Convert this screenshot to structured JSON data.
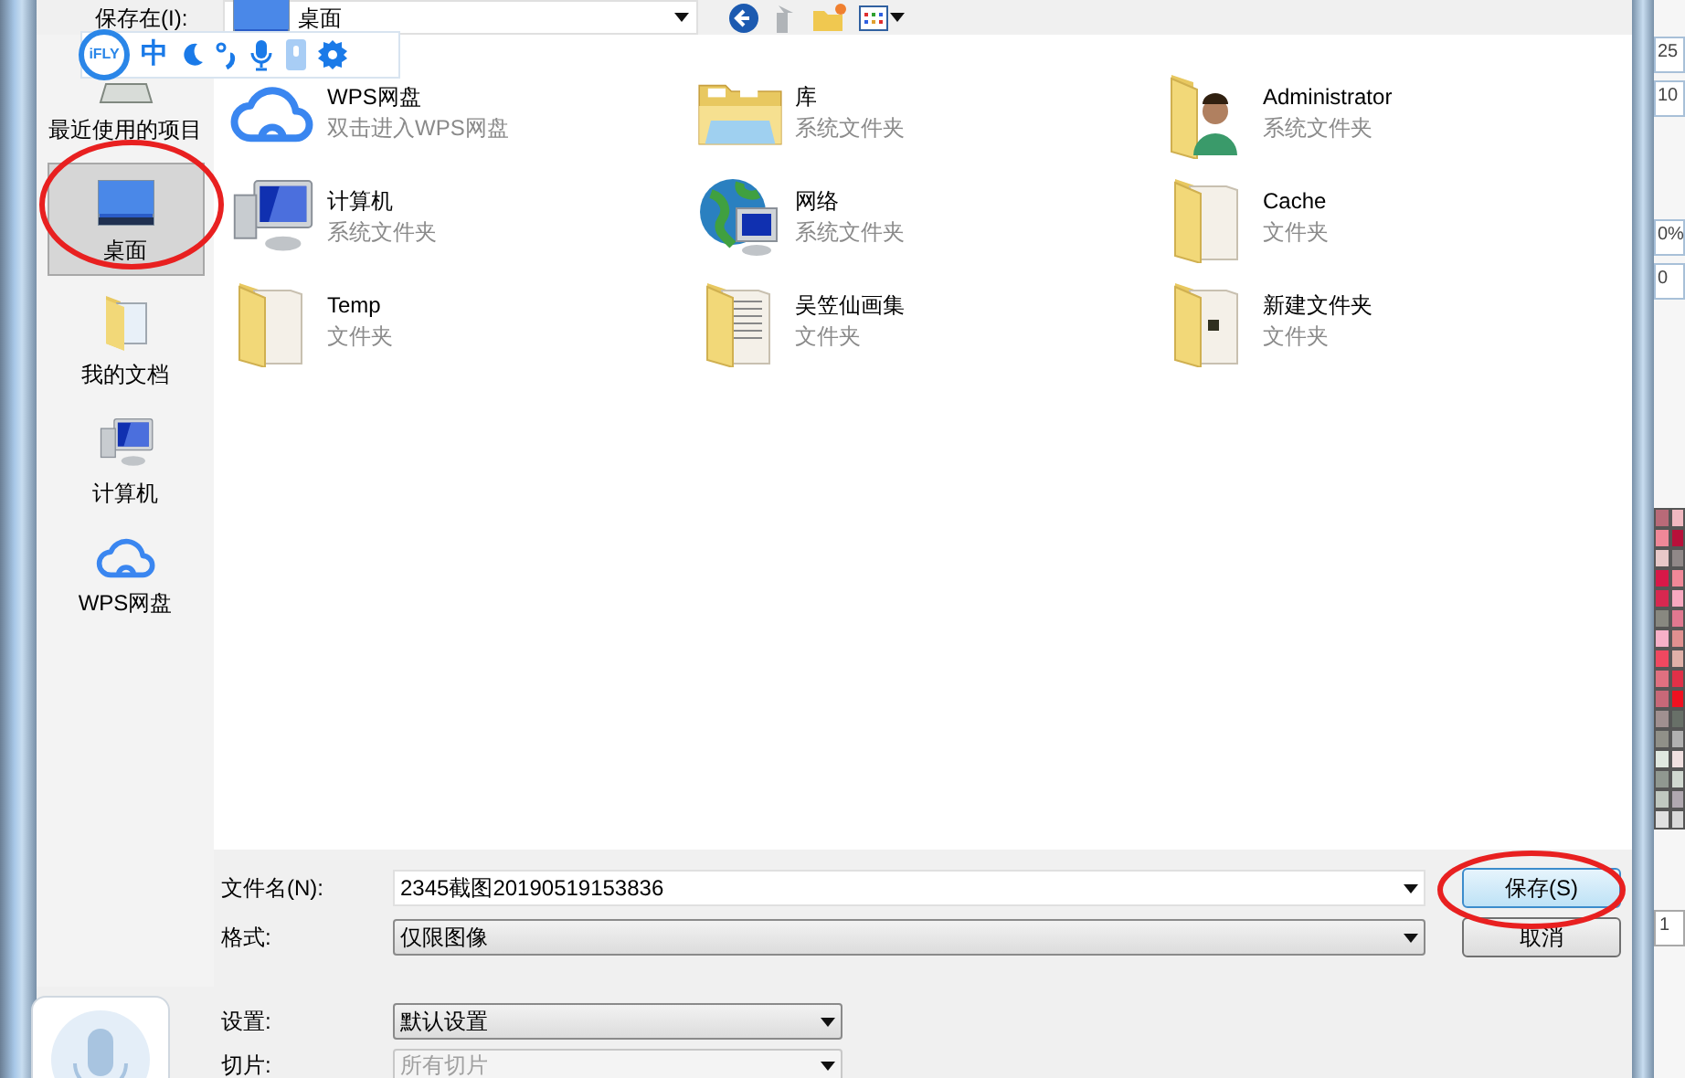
{
  "toolbar": {
    "label": "保存在(I):",
    "location": "桌面"
  },
  "ime_bar": {
    "logo": "iFLY",
    "mode": "中"
  },
  "sidebar": {
    "items": [
      {
        "label": "最近使用的项目",
        "kind": "recent",
        "selected": false
      },
      {
        "label": "桌面",
        "kind": "desktop",
        "selected": true
      },
      {
        "label": "我的文档",
        "kind": "documents",
        "selected": false
      },
      {
        "label": "计算机",
        "kind": "computer",
        "selected": false
      },
      {
        "label": "WPS网盘",
        "kind": "cloud",
        "selected": false
      }
    ]
  },
  "files": [
    {
      "name": "WPS网盘",
      "type": "双击进入WPS网盘",
      "kind": "cloud"
    },
    {
      "name": "库",
      "type": "系统文件夹",
      "kind": "library"
    },
    {
      "name": "Administrator",
      "type": "系统文件夹",
      "kind": "user"
    },
    {
      "name": "计算机",
      "type": "系统文件夹",
      "kind": "computer"
    },
    {
      "name": "网络",
      "type": "系统文件夹",
      "kind": "network"
    },
    {
      "name": "Cache",
      "type": "文件夹",
      "kind": "folder"
    },
    {
      "name": "Temp",
      "type": "文件夹",
      "kind": "folder"
    },
    {
      "name": "吴笠仙画集",
      "type": "文件夹",
      "kind": "docfolder"
    },
    {
      "name": "新建文件夹",
      "type": "文件夹",
      "kind": "imgfolder"
    }
  ],
  "form": {
    "filename_label": "文件名(N):",
    "filename": "2345截图20190519153836",
    "format_label": "格式:",
    "format": "仅限图像",
    "settings_label": "设置:",
    "settings": "默认设置",
    "slice_label": "切片:",
    "slice": "所有切片",
    "slice_disabled": true
  },
  "buttons": [
    {
      "label": "保存(S)",
      "default": true
    },
    {
      "label": "取消",
      "default": false
    }
  ],
  "side_panel": {
    "fields": [
      "25",
      "10",
      "0%",
      "0"
    ],
    "bottom_field": "1",
    "swatches": [
      {
        "color": "#b96a78"
      },
      {
        "color": "#f0b8c0"
      },
      {
        "color": "#f08898"
      },
      {
        "color": "#b8103a"
      },
      {
        "color": "#e8c8c8"
      },
      {
        "color": "#908888"
      },
      {
        "color": "#d81848"
      },
      {
        "color": "#f08898"
      },
      {
        "color": "#d82850"
      },
      {
        "color": "#f8a8c0"
      },
      {
        "color": "#888880"
      },
      {
        "color": "#e07890"
      },
      {
        "color": "#f8b0c8"
      },
      {
        "color": "#e09090"
      },
      {
        "color": "#f04860"
      },
      {
        "color": "#e0b0a8"
      },
      {
        "color": "#e07080"
      },
      {
        "color": "#e03048"
      },
      {
        "color": "#c86878"
      },
      {
        "color": "#f01020"
      },
      {
        "color": "#a09090"
      },
      {
        "color": "#687068"
      },
      {
        "color": "#909088"
      },
      {
        "color": "#b0b0b0"
      },
      {
        "color": "#e0e8e0"
      },
      {
        "color": "#f0e0e0"
      },
      {
        "color": "#909890"
      },
      {
        "color": "#d0d8d0"
      },
      {
        "color": "#c0c8c0"
      },
      {
        "color": "#b0a8b0"
      },
      {
        "color": "#e0e0e0"
      },
      {
        "color": "#d8d8d8"
      }
    ]
  }
}
